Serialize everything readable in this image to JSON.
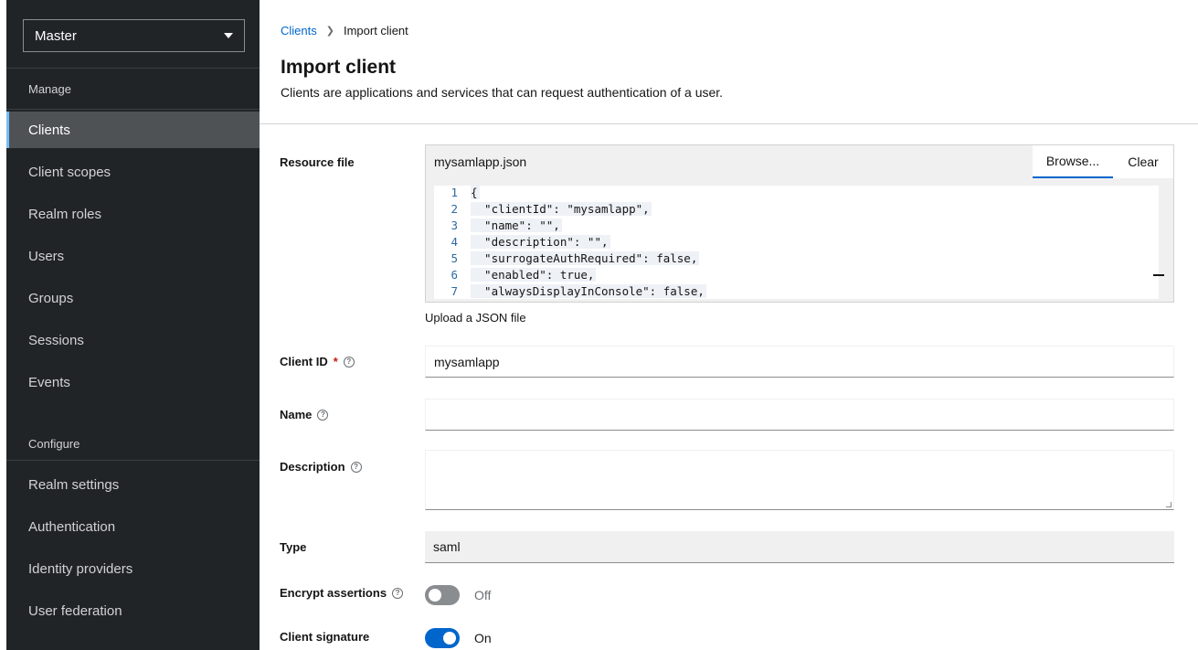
{
  "sidebar": {
    "realm_selector": "Master",
    "manage_title": "Manage",
    "manage_items": [
      "Clients",
      "Client scopes",
      "Realm roles",
      "Users",
      "Groups",
      "Sessions",
      "Events"
    ],
    "configure_title": "Configure",
    "configure_items": [
      "Realm settings",
      "Authentication",
      "Identity providers",
      "User federation"
    ],
    "active_item": "Clients"
  },
  "breadcrumb": {
    "parent": "Clients",
    "current": "Import client"
  },
  "header": {
    "title": "Import client",
    "description": "Clients are applications and services that can request authentication of a user."
  },
  "form": {
    "resource_file": {
      "label": "Resource file",
      "filename": "mysamlapp.json",
      "browse_label": "Browse...",
      "clear_label": "Clear",
      "helper": "Upload a JSON file",
      "code_lines": [
        {
          "n": "1",
          "text": "{"
        },
        {
          "n": "2",
          "text": "  \"clientId\": \"mysamlapp\","
        },
        {
          "n": "3",
          "text": "  \"name\": \"\","
        },
        {
          "n": "4",
          "text": "  \"description\": \"\","
        },
        {
          "n": "5",
          "text": "  \"surrogateAuthRequired\": false,"
        },
        {
          "n": "6",
          "text": "  \"enabled\": true,"
        },
        {
          "n": "7",
          "text": "  \"alwaysDisplayInConsole\": false,"
        }
      ]
    },
    "client_id": {
      "label": "Client ID",
      "required_mark": "*",
      "value": "mysamlapp"
    },
    "name": {
      "label": "Name",
      "value": ""
    },
    "description": {
      "label": "Description",
      "value": ""
    },
    "type": {
      "label": "Type",
      "value": "saml"
    },
    "encrypt_assertions": {
      "label": "Encrypt assertions",
      "state": "Off"
    },
    "client_signature": {
      "label": "Client signature",
      "state": "On"
    },
    "colors": {
      "accent": "#0066cc",
      "sidebar_bg": "#212427",
      "active_border": "#73bcf7",
      "required": "#c9190b"
    }
  }
}
